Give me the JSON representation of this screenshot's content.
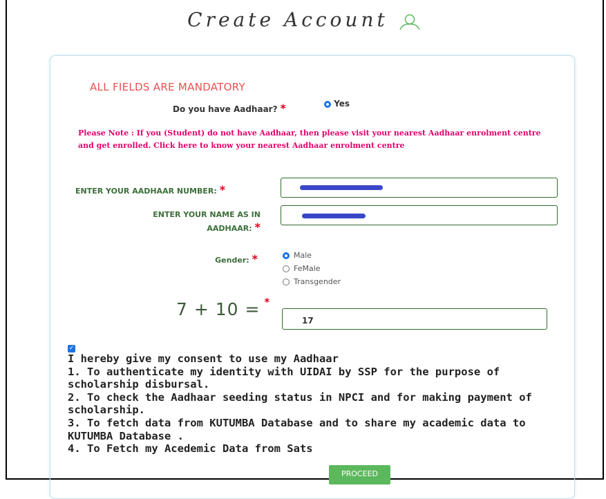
{
  "header": {
    "title": "Create Account",
    "icon": "user-outline-icon"
  },
  "form": {
    "mandatory_note": "ALL FIELDS ARE MANDATORY",
    "aadhaar_question": "Do you have Aadhaar?",
    "required_mark": "*",
    "aadhaar_option": "Yes",
    "notice": "Please Note : If you (Student) do not have Aadhaar, then please visit your nearest Aadhaar enrolment centre and get enrolled. Click here to know your nearest Aadhaar enrolment centre",
    "aadhaar_number_label": "ENTER YOUR AADHAAR NUMBER:",
    "aadhaar_name_label": "ENTER YOUR NAME AS IN AADHAAR:",
    "gender_label": "Gender:",
    "gender_options": [
      "Male",
      "FeMale",
      "Transgender"
    ],
    "gender_selected": "Male",
    "captcha_question": "7 + 10 =",
    "captcha_answer": "17",
    "consent_checked": true,
    "consent_lines": [
      "I hereby give my consent to use my Aadhaar",
      "1. To authenticate my identity with UIDAI by SSP for the purpose of scholarship disbursal.",
      "2. To check the Aadhaar seeding status in NPCI and for making payment of scholarship.",
      "3. To fetch data from KUTUMBA Database and to share my academic data to KUTUMBA Database .",
      "4. To Fetch my Acedemic Data from Sats"
    ],
    "proceed_label": "PROCEED"
  },
  "colors": {
    "accent": "#1a73e8",
    "notice": "#e3006b",
    "mandatory": "#e8504f",
    "label_green": "#3c6e3a",
    "button_green": "#5cb85c"
  }
}
